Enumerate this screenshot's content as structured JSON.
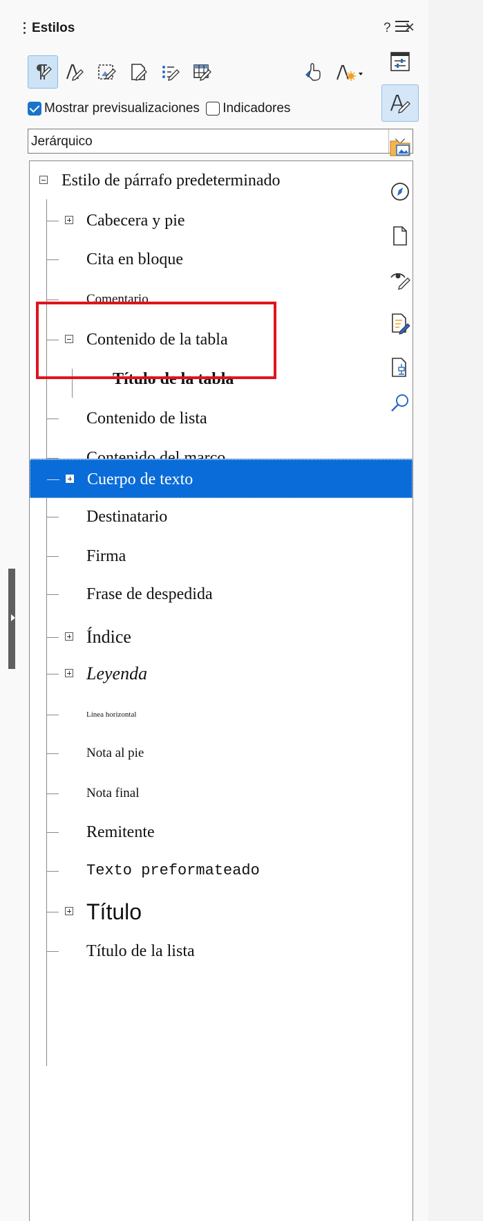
{
  "panel": {
    "title": "Estilos",
    "help_label": "?",
    "close_label": "×",
    "menu_label": "≡"
  },
  "toolbar": {
    "buttons": [
      {
        "icon": "paragraph-styles-icon",
        "active": true
      },
      {
        "icon": "character-styles-icon",
        "active": false
      },
      {
        "icon": "frame-styles-icon",
        "active": false
      },
      {
        "icon": "page-styles-icon",
        "active": false
      },
      {
        "icon": "list-styles-icon",
        "active": false
      },
      {
        "icon": "table-styles-icon",
        "active": false
      },
      {
        "icon": "fill-format-mode-icon",
        "active": false
      },
      {
        "icon": "new-style-from-selection-icon",
        "active": false
      }
    ]
  },
  "options": {
    "show_previews_label": "Mostrar previsualizaciones",
    "show_previews_checked": true,
    "spotlight_label": "Indicadores",
    "spotlight_checked": false
  },
  "filter": {
    "selected": "Jerárquico"
  },
  "tree": {
    "root": "Estilo de párrafo predeterminado",
    "items": [
      {
        "label": "Cabecera y pie",
        "expander": "plus"
      },
      {
        "label": "Cita en bloque",
        "expander": "none"
      },
      {
        "label": "Comentario",
        "expander": "none"
      },
      {
        "label": "Contenido de la tabla",
        "expander": "minus"
      },
      {
        "label": "Título de la tabla",
        "expander": "none",
        "child": true
      },
      {
        "label": "Contenido de lista",
        "expander": "none"
      },
      {
        "label": "Contenido del marco",
        "expander": "none"
      },
      {
        "label": "Cuerpo de texto",
        "expander": "plus",
        "selected": true
      },
      {
        "label": "Destinatario",
        "expander": "none"
      },
      {
        "label": "Firma",
        "expander": "none"
      },
      {
        "label": "Frase de despedida",
        "expander": "none"
      },
      {
        "label": "Índice",
        "expander": "plus"
      },
      {
        "label": "Leyenda",
        "expander": "plus"
      },
      {
        "label": "Línea horizontal",
        "expander": "none"
      },
      {
        "label": "Nota al pie",
        "expander": "none"
      },
      {
        "label": "Nota final",
        "expander": "none"
      },
      {
        "label": "Remitente",
        "expander": "none"
      },
      {
        "label": "Texto preformateado",
        "expander": "none"
      },
      {
        "label": "Título",
        "expander": "plus"
      },
      {
        "label": "Título de la lista",
        "expander": "none"
      }
    ]
  },
  "sidebar_tabs": [
    {
      "icon": "properties-icon",
      "active": false
    },
    {
      "icon": "styles-icon",
      "active": true
    },
    {
      "icon": "gallery-icon",
      "active": false
    },
    {
      "icon": "navigator-icon",
      "active": false
    },
    {
      "icon": "page-icon",
      "active": false
    },
    {
      "icon": "style-inspector-icon",
      "active": false
    },
    {
      "icon": "manage-changes-icon",
      "active": false
    },
    {
      "icon": "design-icon",
      "active": false
    },
    {
      "icon": "find-icon",
      "active": false
    }
  ],
  "colors": {
    "selection": "#0a6cd8",
    "highlight_box": "#e0141e",
    "active_tab": "#d4e6f8"
  }
}
